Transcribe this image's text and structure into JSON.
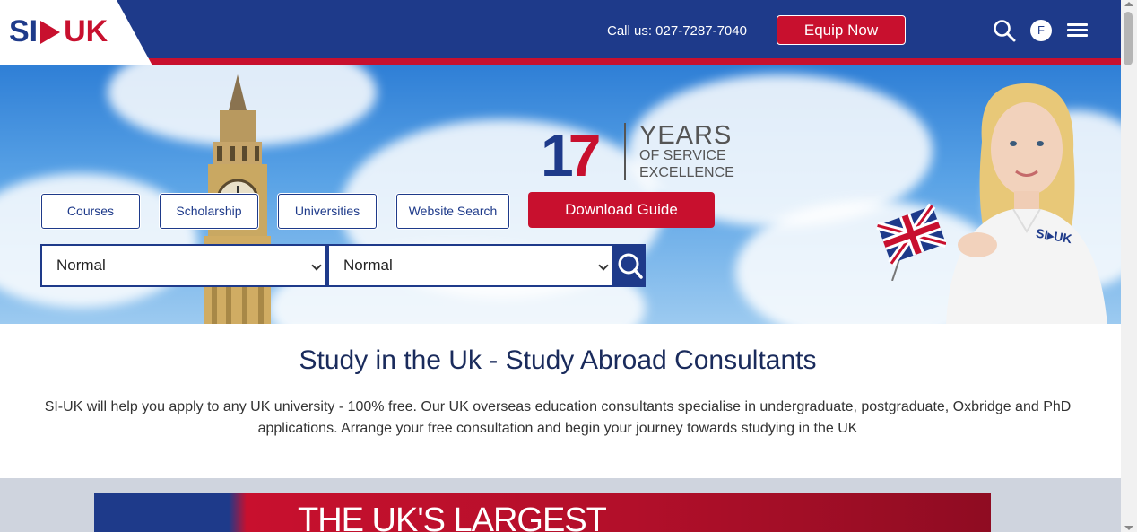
{
  "header": {
    "logo_si": "SI",
    "logo_uk": "UK",
    "callus": "Call us: 027-7287-7040",
    "equip_btn": "Equip Now",
    "avatar_letter": "F"
  },
  "hero": {
    "years_number_1": "1",
    "years_number_7": "7",
    "years_line1": "YEARS",
    "years_line2": "OF SERVICE",
    "years_line3": "EXCELLENCE",
    "pills": [
      "Courses",
      "Scholarship",
      "Universities",
      "Website Search"
    ],
    "download_btn": "Download Guide",
    "select_1_value": "Normal",
    "select_2_value": "Normal",
    "shirt_logo": "SI▸UK"
  },
  "content": {
    "title": "Study in the Uk - Study Abroad Consultants",
    "description": "SI-UK will help you apply to any UK university - 100% free. Our UK overseas education consultants specialise in undergraduate, postgraduate, Oxbridge and PhD applications. Arrange your free consultation and begin your journey towards studying in the UK"
  },
  "banner": {
    "text": "THE UK'S LARGEST"
  },
  "colors": {
    "navy": "#1e3a8a",
    "red": "#c8102e"
  },
  "icons": [
    "search-icon",
    "menu-icon",
    "chevron-down-icon"
  ]
}
